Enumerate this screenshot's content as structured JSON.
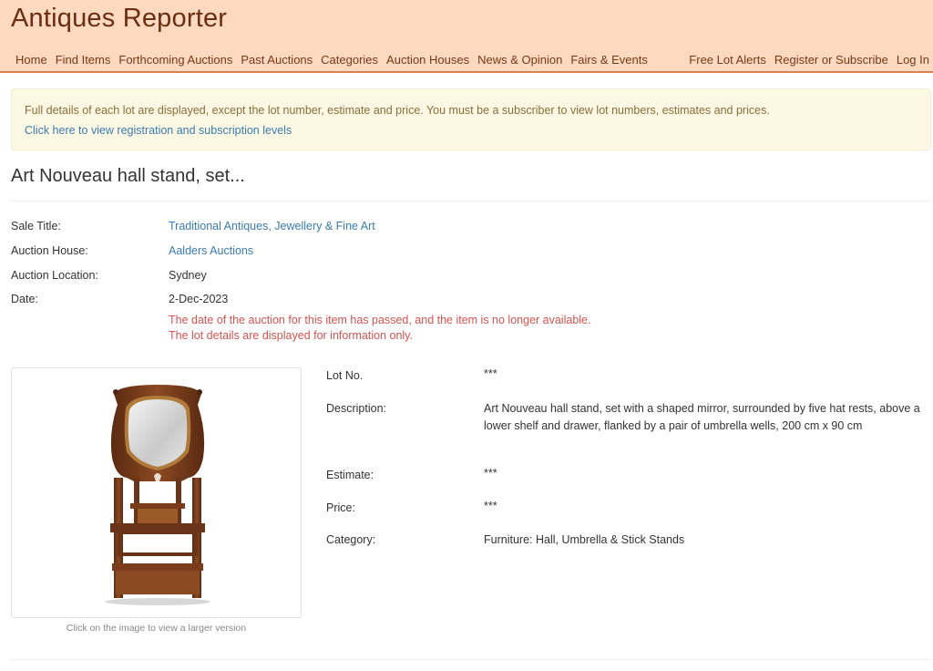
{
  "header": {
    "logo": "Antiques Reporter",
    "nav_left": [
      "Home",
      "Find Items",
      "Forthcoming Auctions",
      "Past Auctions",
      "Categories",
      "Auction Houses",
      "News & Opinion",
      "Fairs & Events"
    ],
    "nav_right": [
      "Free Lot Alerts",
      "Register or Subscribe",
      "Log In"
    ]
  },
  "notice": {
    "text": "Full details of each lot are displayed, except the lot number, estimate and price. You must be a subscriber to view lot numbers, estimates and prices.",
    "link": "Click here to view registration and subscription levels"
  },
  "lot": {
    "title": "Art Nouveau hall stand, set...",
    "sale_title_label": "Sale Title:",
    "sale_title": "Traditional Antiques, Jewellery & Fine Art",
    "auction_house_label": "Auction House:",
    "auction_house": "Aalders Auctions",
    "location_label": "Auction Location:",
    "location": "Sydney",
    "date_label": "Date:",
    "date": "2-Dec-2023",
    "warning_line1": "The date of the auction for this item has passed, and the item is no longer available.",
    "warning_line2": "The lot details are displayed for information only."
  },
  "image": {
    "caption": "Click on the image to view a larger version"
  },
  "details": {
    "lot_no_label": "Lot No.",
    "lot_no": "***",
    "description_label": "Description:",
    "description": "Art Nouveau hall stand, set with a shaped mirror, surrounded by five hat rests, above a lower shelf and drawer, flanked by a pair of umbrella wells, 200 cm x 90 cm",
    "estimate_label": "Estimate:",
    "estimate": "***",
    "price_label": "Price:",
    "price": "***",
    "category_label": "Category:",
    "category": "Furniture: Hall, Umbrella & Stick Stands"
  }
}
